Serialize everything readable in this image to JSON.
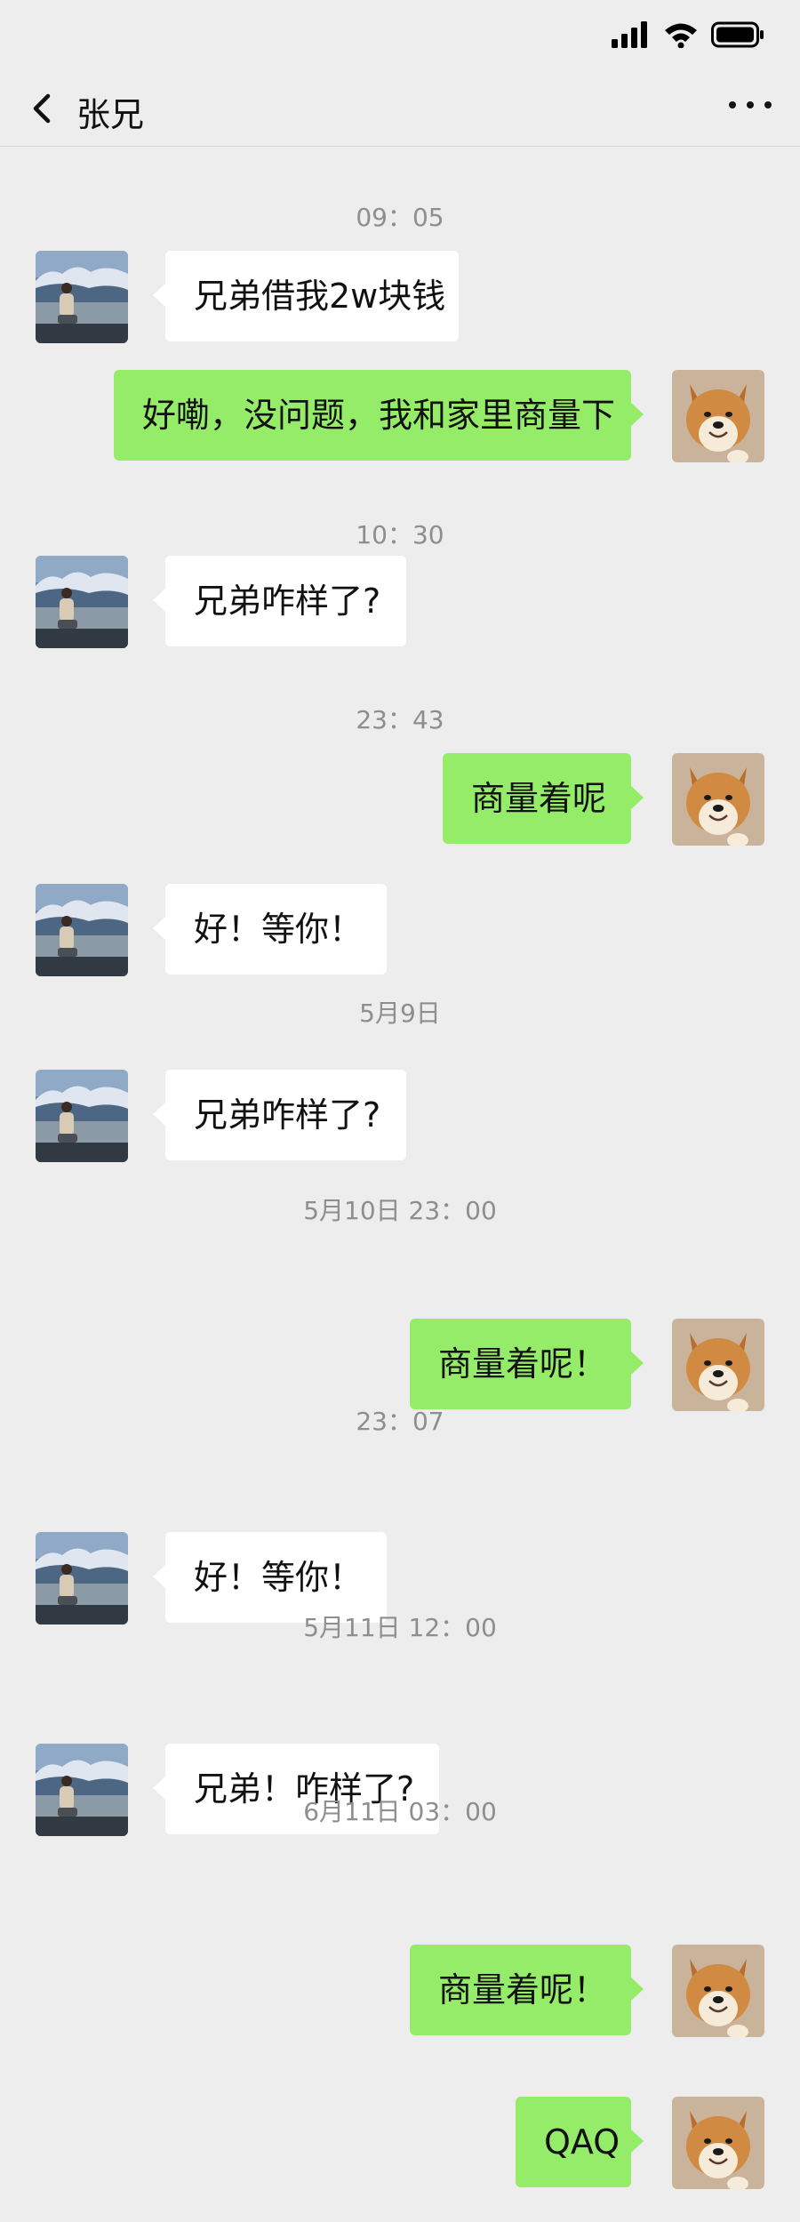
{
  "header": {
    "title": "张兄",
    "back_icon": "chevron-left-icon",
    "more_icon": "more-dots-icon"
  },
  "status_bar": {
    "icons": [
      "signal-icon",
      "wifi-icon",
      "battery-icon"
    ]
  },
  "colors": {
    "background": "#ededed",
    "outgoing_bubble": "#95ec69",
    "incoming_bubble": "#ffffff",
    "timestamp": "#8e8e8e"
  },
  "timeline": [
    {
      "type": "time",
      "text": "09：05"
    },
    {
      "type": "msg",
      "from": "in",
      "text": "兄弟借我2w块钱"
    },
    {
      "type": "msg",
      "from": "out",
      "text": "好嘞，没问题，我和家里商量下"
    },
    {
      "type": "time",
      "text": "10：30"
    },
    {
      "type": "msg",
      "from": "in",
      "text": "兄弟咋样了?"
    },
    {
      "type": "time",
      "text": "23：43"
    },
    {
      "type": "msg",
      "from": "out",
      "text": "商量着呢"
    },
    {
      "type": "msg",
      "from": "in",
      "text": "好！等你！"
    },
    {
      "type": "time",
      "text": "5月9日"
    },
    {
      "type": "msg",
      "from": "in",
      "text": "兄弟咋样了?"
    },
    {
      "type": "time",
      "text": "5月10日 23：00"
    },
    {
      "type": "msg",
      "from": "out",
      "text": "商量着呢！"
    },
    {
      "type": "time",
      "text": "23：07"
    },
    {
      "type": "msg",
      "from": "in",
      "text": "好！等你！"
    },
    {
      "type": "time",
      "text": "5月11日 12：00"
    },
    {
      "type": "msg",
      "from": "in",
      "text": "兄弟！咋样了?"
    },
    {
      "type": "time",
      "text": "6月11日 03：00"
    },
    {
      "type": "msg",
      "from": "out",
      "text": "商量着呢！"
    },
    {
      "type": "msg",
      "from": "out",
      "text": "QAQ"
    }
  ]
}
